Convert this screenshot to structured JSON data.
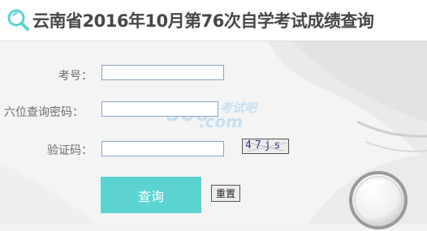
{
  "header": {
    "title": "云南省2016年10月第76次自学考试成绩查询",
    "icon": "search-icon",
    "accent_color": "#5bd3d1"
  },
  "form": {
    "exam_number": {
      "label": "考号：",
      "value": ""
    },
    "id_password": {
      "label": "六位查询密码：",
      "value": ""
    },
    "verify_code": {
      "label": "验证码：",
      "value": ""
    },
    "captcha_text": "47js"
  },
  "buttons": {
    "query_label": "查询",
    "query_color": "#5bd3d1",
    "reset_label": "重置"
  },
  "watermark": {
    "number": "500",
    "brand": "考试吧",
    "domain": ".com"
  }
}
